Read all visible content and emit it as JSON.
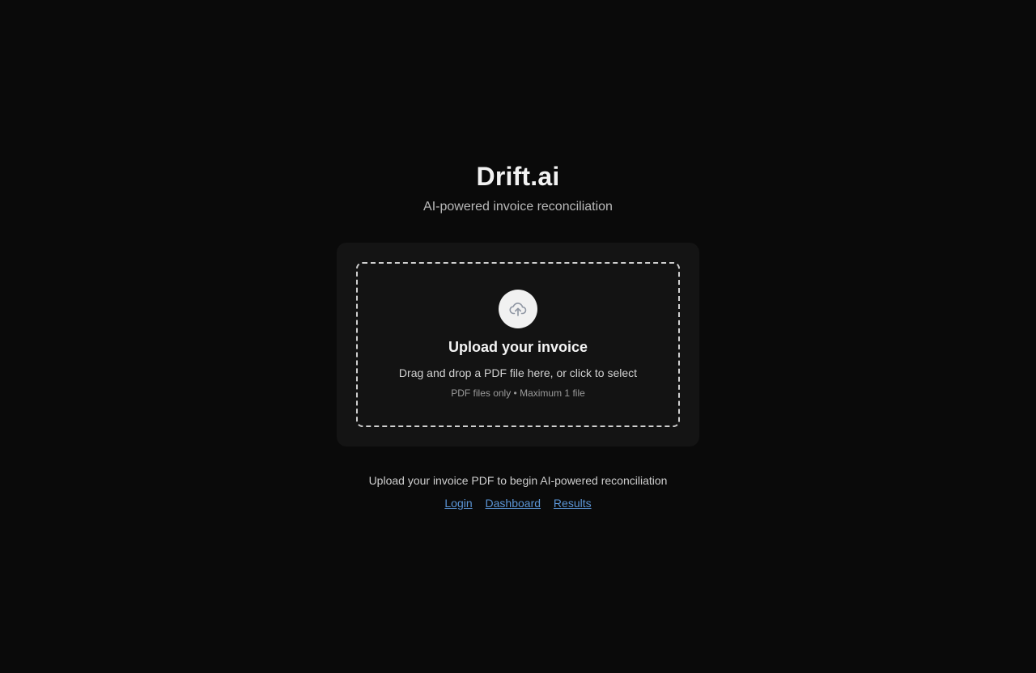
{
  "header": {
    "brand": "Drift.ai",
    "tagline": "AI-powered invoice reconciliation"
  },
  "upload": {
    "icon": "cloud-upload-icon",
    "title": "Upload your invoice",
    "instructions": "Drag and drop a PDF file here, or click to select",
    "constraints": "PDF files only • Maximum 1 file"
  },
  "footer": {
    "text": "Upload your invoice PDF to begin AI-powered reconciliation",
    "links": [
      {
        "label": "Login"
      },
      {
        "label": "Dashboard"
      },
      {
        "label": "Results"
      }
    ]
  },
  "colors": {
    "background": "#0a0a0a",
    "card": "#141414",
    "link": "#5b95d6"
  }
}
